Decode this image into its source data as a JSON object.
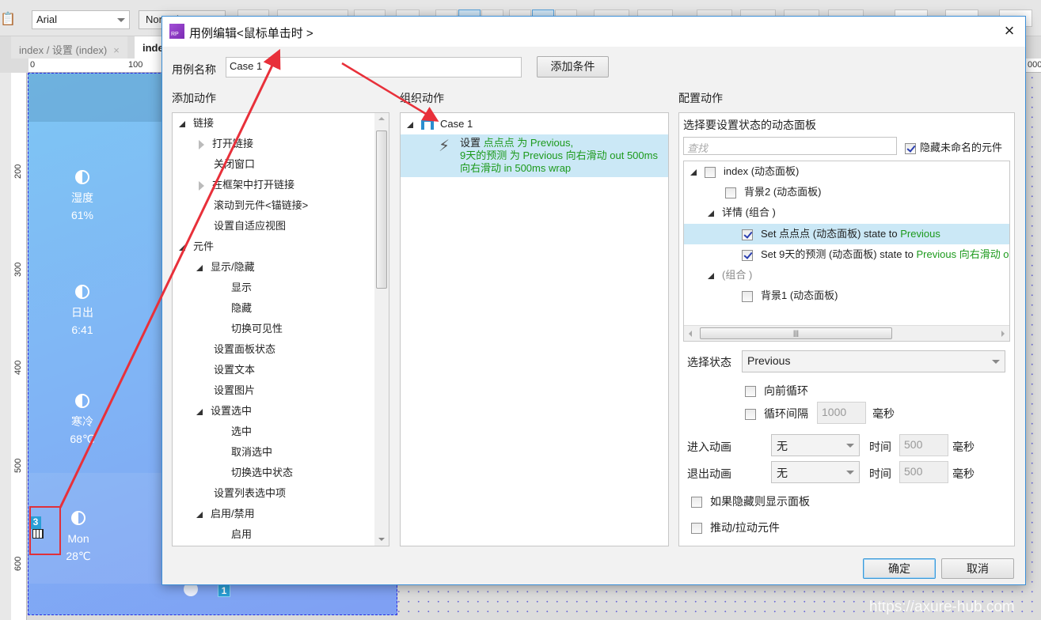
{
  "toolbar": {
    "font_family": "Arial",
    "font_style": "Normal"
  },
  "tabs": [
    {
      "label": "index / 设置 (index)",
      "close": "×"
    },
    {
      "label": "index"
    }
  ],
  "rulers": {
    "h": [
      "0",
      "100",
      "000"
    ],
    "v": [
      "200",
      "300",
      "400",
      "500",
      "600"
    ]
  },
  "canvas": {
    "weather_items": [
      {
        "label": "湿度",
        "value": "61%"
      },
      {
        "label": "日出",
        "value": "6:41"
      },
      {
        "label": "寒冷",
        "value": "68℃"
      },
      {
        "label": "Mon",
        "value": "28℃"
      }
    ],
    "badge_left": "3",
    "badge_bottom": "1"
  },
  "dialog": {
    "title": "用例编辑<鼠标单击时 >",
    "logo": "RP",
    "close": "×",
    "case_name_label": "用例名称",
    "case_name_value": "Case 1",
    "add_condition": "添加条件",
    "add_action": {
      "title": "添加动作",
      "items": [
        {
          "label": "链接",
          "level": 0,
          "expand": "open"
        },
        {
          "label": "打开链接",
          "level": 1,
          "expand": "closed"
        },
        {
          "label": "关闭窗口",
          "level": 1,
          "expand": "none"
        },
        {
          "label": "在框架中打开链接",
          "level": 1,
          "expand": "closed"
        },
        {
          "label": "滚动到元件<锚链接>",
          "level": 1,
          "expand": "none"
        },
        {
          "label": "设置自适应视图",
          "level": 1,
          "expand": "none"
        },
        {
          "label": "元件",
          "level": 0,
          "expand": "open"
        },
        {
          "label": "显示/隐藏",
          "level": 1,
          "expand": "open"
        },
        {
          "label": "显示",
          "level": 2,
          "expand": "none"
        },
        {
          "label": "隐藏",
          "level": 2,
          "expand": "none"
        },
        {
          "label": "切换可见性",
          "level": 2,
          "expand": "none"
        },
        {
          "label": "设置面板状态",
          "level": 1,
          "expand": "none"
        },
        {
          "label": "设置文本",
          "level": 1,
          "expand": "none"
        },
        {
          "label": "设置图片",
          "level": 1,
          "expand": "none"
        },
        {
          "label": "设置选中",
          "level": 1,
          "expand": "open"
        },
        {
          "label": "选中",
          "level": 2,
          "expand": "none"
        },
        {
          "label": "取消选中",
          "level": 2,
          "expand": "none"
        },
        {
          "label": "切换选中状态",
          "level": 2,
          "expand": "none"
        },
        {
          "label": "设置列表选中项",
          "level": 1,
          "expand": "none"
        },
        {
          "label": "启用/禁用",
          "level": 1,
          "expand": "open"
        },
        {
          "label": "启用",
          "level": 2,
          "expand": "none"
        }
      ]
    },
    "organize": {
      "title": "组织动作",
      "case": "Case 1",
      "action": {
        "prefix": "设置",
        "line1_green": "点点点 为 Previous,",
        "line2_green": "9天的预测 为 Previous 向右滑动 out 500ms",
        "line3_green": "向右滑动 in 500ms wrap"
      }
    },
    "configure": {
      "title": "配置动作",
      "panel_title": "选择要设置状态的动态面板",
      "search_placeholder": "查找",
      "hide_unnamed_label": "隐藏未命名的元件",
      "hide_unnamed_checked": true,
      "tree": [
        {
          "label": "index (动态面板)",
          "checked": false,
          "level": 0
        },
        {
          "label": "背景2 (动态面板)",
          "checked": false,
          "level": 1
        },
        {
          "label": "详情 (组合 )",
          "group": true,
          "level": 0
        },
        {
          "prefix": "Set 点点点 (动态面板) state to ",
          "green": "Previous",
          "checked": true,
          "selected": true
        },
        {
          "prefix": "Set 9天的预测 (动态面板) state to ",
          "green": "Previous 向右滑动 o",
          "checked": true
        },
        {
          "label": "(组合 )",
          "group": true,
          "level": 0
        },
        {
          "label": "背景1 (动态面板)",
          "checked": false
        }
      ],
      "select_state_label": "选择状态",
      "select_state_value": "Previous",
      "loop_forward_label": "向前循环",
      "loop_interval_label": "循环间隔",
      "loop_interval_value": "1000",
      "ms": "毫秒",
      "enter_anim_label": "进入动画",
      "enter_anim_value": "无",
      "exit_anim_label": "退出动画",
      "exit_anim_value": "无",
      "time_label": "时间",
      "enter_time": "500",
      "exit_time": "500",
      "show_if_hidden_label": "如果隐藏则显示面板",
      "push_pull_label": "推动/拉动元件"
    },
    "ok": "确定",
    "cancel": "取消"
  },
  "watermark": "https://axure-hub.com",
  "annotation_color": "#e8303a"
}
